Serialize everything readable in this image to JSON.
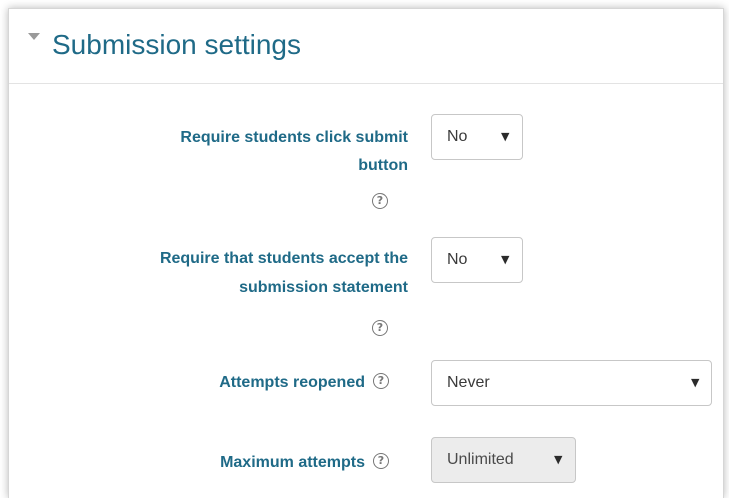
{
  "section": {
    "title": "Submission settings"
  },
  "fields": {
    "require_submit": {
      "label_line1": "Require students click submit",
      "label_line2": "button",
      "value": "No"
    },
    "accept_statement": {
      "label_line1": "Require that students accept the",
      "label_line2": "submission statement",
      "value": "No"
    },
    "attempts_reopened": {
      "label": "Attempts reopened",
      "value": "Never"
    },
    "max_attempts": {
      "label": "Maximum attempts",
      "value": "Unlimited"
    }
  },
  "icons": {
    "help": "?",
    "dropdown": "▼"
  },
  "colors": {
    "label": "#1f6a87",
    "title": "#1f6a87"
  }
}
